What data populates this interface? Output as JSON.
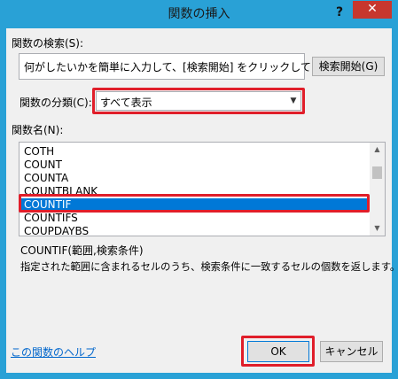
{
  "window": {
    "title": "関数の挿入",
    "help_glyph": "?",
    "close_glyph": "✕"
  },
  "search": {
    "label": "関数の検索(S):",
    "text": "何がしたいかを簡単に入力して、[検索開始] をクリックしてください。",
    "button_label": "検索開始(G)"
  },
  "category": {
    "label": "関数の分類(C):",
    "value": "すべて表示"
  },
  "function_list": {
    "label": "関数名(N):",
    "items": [
      "COTH",
      "COUNT",
      "COUNTA",
      "COUNTBLANK",
      "COUNTIF",
      "COUNTIFS",
      "COUPDAYBS"
    ],
    "selected": "COUNTIF"
  },
  "syntax": "COUNTIF(範囲,検索条件)",
  "description": "指定された範囲に含まれるセルのうち、検索条件に一致するセルの個数を返します。",
  "help_link": "この関数のヘルプ",
  "buttons": {
    "ok": "OK",
    "cancel": "キャンセル"
  },
  "colors": {
    "titlebar": "#29a1d6",
    "close": "#c7372e",
    "selection": "#0078d7",
    "highlight": "#e01e2a",
    "link": "#0066cc"
  }
}
